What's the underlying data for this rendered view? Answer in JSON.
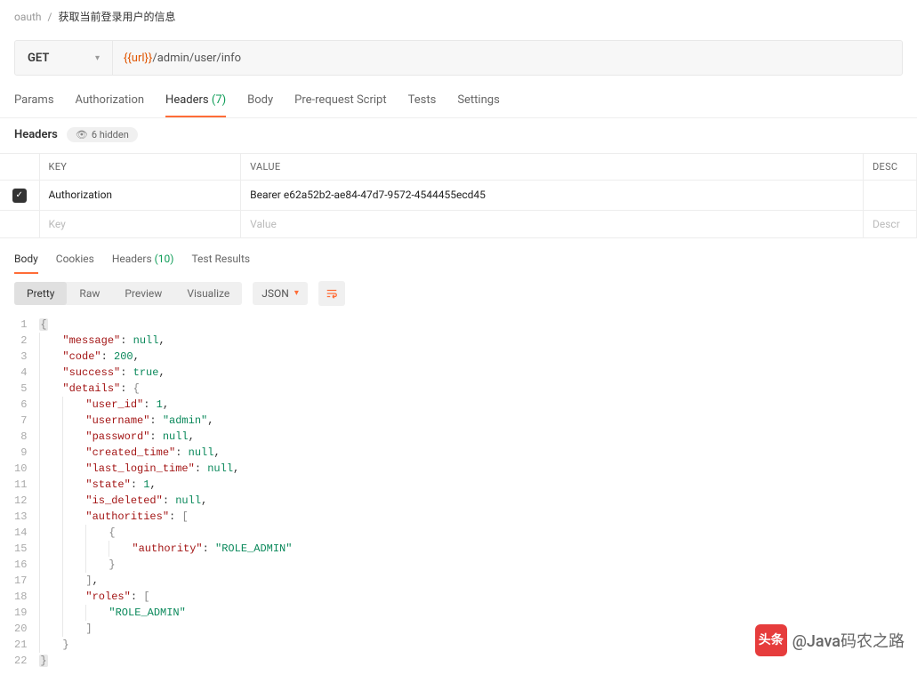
{
  "breadcrumb": {
    "collection": "oauth",
    "name": "获取当前登录用户的信息"
  },
  "request": {
    "method": "GET",
    "url_var": "{{url}}",
    "url_path": "/admin/user/info"
  },
  "tabs": {
    "params": "Params",
    "auth": "Authorization",
    "headers": "Headers",
    "headers_count": "(7)",
    "body": "Body",
    "prerequest": "Pre-request Script",
    "tests": "Tests",
    "settings": "Settings"
  },
  "headers_section": {
    "label": "Headers",
    "hidden": "6 hidden"
  },
  "kv": {
    "col_key": "KEY",
    "col_value": "VALUE",
    "col_desc": "DESC",
    "row1_key": "Authorization",
    "row1_value": "Bearer e62a52b2-ae84-47d7-9572-4544455ecd45",
    "placeholder_key": "Key",
    "placeholder_value": "Value",
    "placeholder_desc": "Descr"
  },
  "response_tabs": {
    "body": "Body",
    "cookies": "Cookies",
    "headers": "Headers",
    "headers_count": "(10)",
    "tests": "Test Results"
  },
  "view": {
    "pretty": "Pretty",
    "raw": "Raw",
    "preview": "Preview",
    "visualize": "Visualize",
    "format": "JSON"
  },
  "json_keys": {
    "message": "\"message\"",
    "code": "\"code\"",
    "success": "\"success\"",
    "details": "\"details\"",
    "user_id": "\"user_id\"",
    "username": "\"username\"",
    "password": "\"password\"",
    "created_time": "\"created_time\"",
    "last_login_time": "\"last_login_time\"",
    "state": "\"state\"",
    "is_deleted": "\"is_deleted\"",
    "authorities": "\"authorities\"",
    "authority": "\"authority\"",
    "roles": "\"roles\""
  },
  "json_vals": {
    "null": "null",
    "code": "200",
    "true": "true",
    "one": "1",
    "admin": "\"admin\"",
    "role_admin": "\"ROLE_ADMIN\""
  },
  "line_numbers": [
    "1",
    "2",
    "3",
    "4",
    "5",
    "6",
    "7",
    "8",
    "9",
    "10",
    "11",
    "12",
    "13",
    "14",
    "15",
    "16",
    "17",
    "18",
    "19",
    "20",
    "21",
    "22"
  ],
  "watermark": {
    "icon": "头条",
    "text": "@Java码农之路"
  }
}
